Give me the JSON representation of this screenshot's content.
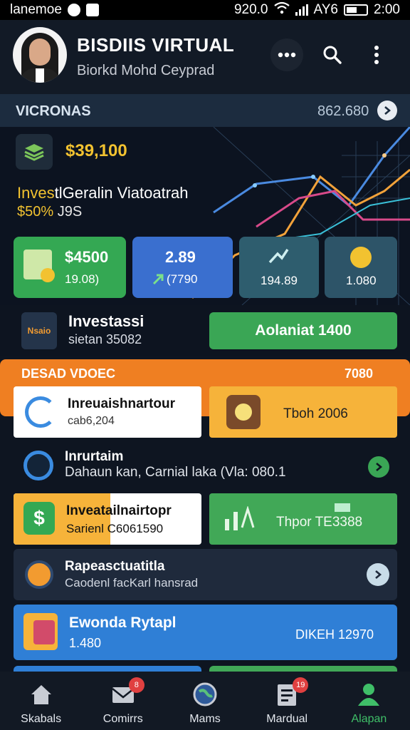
{
  "status_bar": {
    "carrier": "lanemoe",
    "speed": "920.0",
    "network_label": "AY6",
    "time": "2:00"
  },
  "header": {
    "title": "BISDIIS VIRTUAL",
    "subtitle": "Biorkd Mohd Ceyprad"
  },
  "section": {
    "title": "VICRONAS",
    "value": "862.680"
  },
  "hero": {
    "amount": "$39,100",
    "line1_prefix": "Inves",
    "line1_rest": "tlGeralin Viatoatrah",
    "line2_value": "$50%",
    "line2_rest": " J9S"
  },
  "tiles": [
    {
      "value": "$4500",
      "sub": "19.08)"
    },
    {
      "value": "2.89",
      "sub": "(7790"
    },
    {
      "value": "",
      "sub": "194.89"
    },
    {
      "value": "",
      "sub": "1.080"
    }
  ],
  "investment": {
    "title": "Investassi",
    "subtitle": "sietan 35082",
    "icon_text": "Nsaio",
    "button_label": "Aolaniat 1400"
  },
  "banner": {
    "title": "DESAD VDOEC",
    "value": "7080"
  },
  "cards": {
    "white": {
      "title": "Inreuaishnartour",
      "sub": "cab6,204"
    },
    "yellow": {
      "label": "Tboh 2006"
    },
    "row1": {
      "title": "Inrurtaim",
      "sub": "Dahaun kan, Carnial laka (Vla: 080.1"
    },
    "mix": {
      "title": "Inveatailnairtopr",
      "sub": "Sarienl C6061590"
    },
    "green": {
      "label": "Thpor TE3388"
    },
    "dark": {
      "title": "Rapeasctuatitla",
      "sub": "Caodenl facKarl hansrad"
    },
    "blue": {
      "title": "Ewonda Rytapl",
      "sub": "1.480",
      "right": "DIKEH 12970"
    }
  },
  "nav": [
    {
      "label": "Skabals",
      "icon": "home-icon",
      "badge": ""
    },
    {
      "label": "Comirrs",
      "icon": "mail-icon",
      "badge": "8"
    },
    {
      "label": "Mams",
      "icon": "globe-icon",
      "badge": ""
    },
    {
      "label": "Mardual",
      "icon": "document-icon",
      "badge": "19"
    },
    {
      "label": "Alapan",
      "icon": "user-icon",
      "badge": ""
    }
  ],
  "colors": {
    "accent_green": "#3aa655",
    "accent_orange": "#ef7f22",
    "accent_yellow": "#f2c230",
    "accent_blue": "#2f7fd6"
  }
}
